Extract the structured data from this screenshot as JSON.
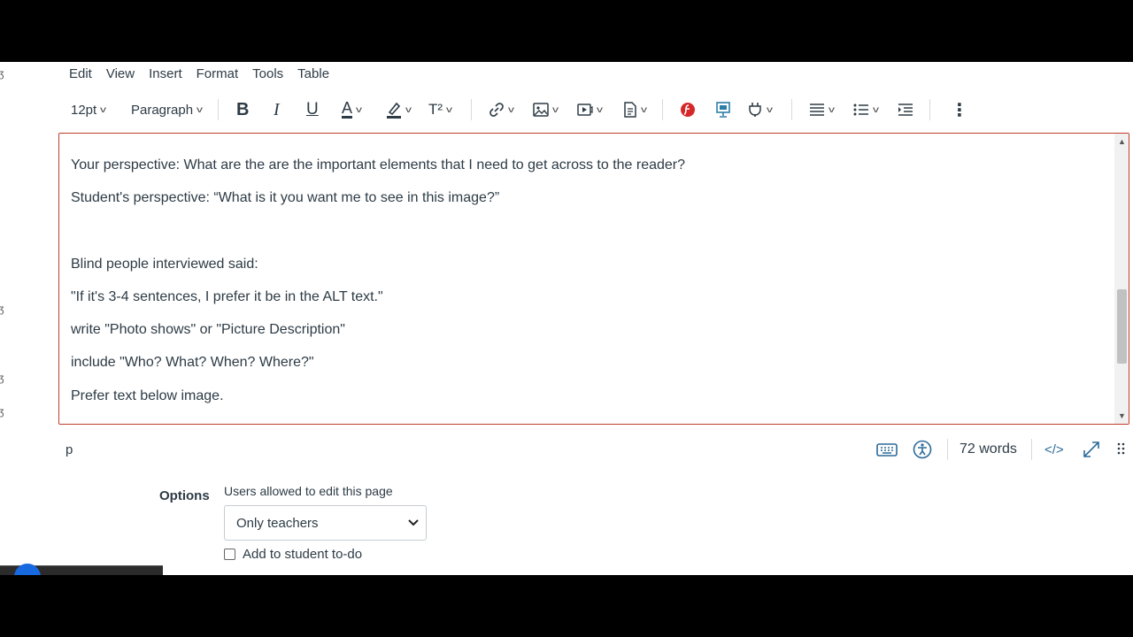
{
  "menubar": [
    "Edit",
    "View",
    "Insert",
    "Format",
    "Tools",
    "Table"
  ],
  "toolbar": {
    "font_size": "12pt",
    "block_format": "Paragraph",
    "bold_glyph": "B",
    "italic_glyph": "I",
    "underline_glyph": "U",
    "text_color_glyph": "A",
    "superscript_glyph": "T²",
    "more_glyph": "⋮"
  },
  "editor": {
    "lines": [
      "Your perspective:  What are the are the important elements that I need to get across to the reader?",
      "Student's perspective: “What is it you want me to see in this image?”",
      "",
      "Blind people interviewed said:",
      "\"If it's 3-4 sentences, I prefer it be in the ALT text.\"",
      "write \"Photo shows\" or \"Picture Description\"",
      "include \"Who? What? When? Where?\"",
      "Prefer text below image."
    ]
  },
  "statusbar": {
    "element_path": "p",
    "word_count": "72 words",
    "html_toggle": "</>"
  },
  "options": {
    "label": "Options",
    "edit_permission_label": "Users allowed to edit this page",
    "edit_permission_value": "Only teachers",
    "todo_label": "Add to student to-do"
  },
  "colors": {
    "editor_border": "#c23c2d",
    "accent": "#1769e0",
    "text": "#2d3b45",
    "doc_icon_red": "#d62828",
    "media_icon_teal": "#2b7fa6"
  }
}
